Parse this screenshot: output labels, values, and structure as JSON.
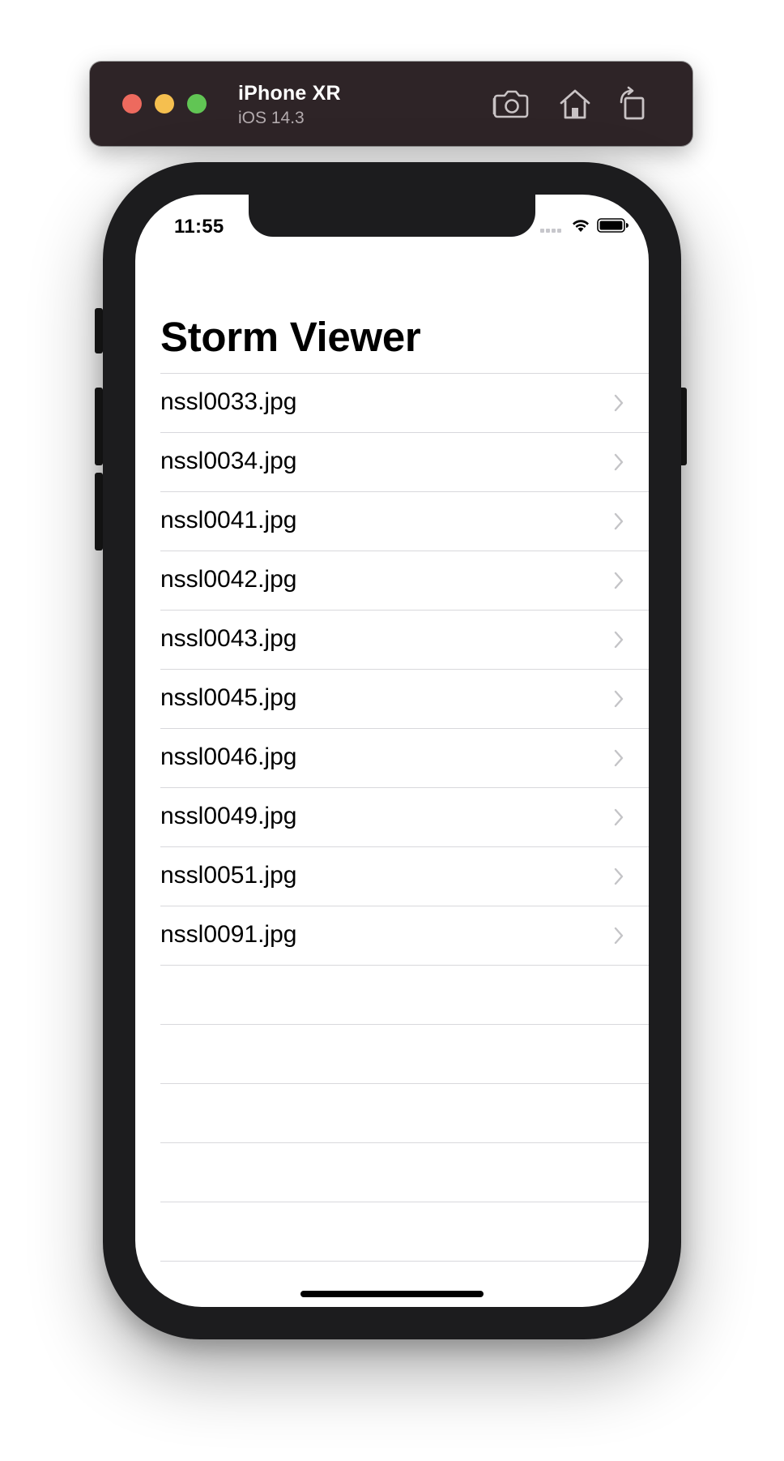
{
  "simulator": {
    "device_name": "iPhone XR",
    "os_version": "iOS 14.3",
    "icons": [
      "screenshot-icon",
      "home-icon",
      "rotate-icon"
    ]
  },
  "status_bar": {
    "time": "11:55",
    "icons": [
      "cellular-signal-icon",
      "wifi-icon",
      "battery-icon"
    ]
  },
  "navigation": {
    "title": "Storm Viewer"
  },
  "list": {
    "items": [
      {
        "label": "nssl0033.jpg"
      },
      {
        "label": "nssl0034.jpg"
      },
      {
        "label": "nssl0041.jpg"
      },
      {
        "label": "nssl0042.jpg"
      },
      {
        "label": "nssl0043.jpg"
      },
      {
        "label": "nssl0045.jpg"
      },
      {
        "label": "nssl0046.jpg"
      },
      {
        "label": "nssl0049.jpg"
      },
      {
        "label": "nssl0051.jpg"
      },
      {
        "label": "nssl0091.jpg"
      }
    ]
  },
  "colors": {
    "toolbar_bg": "#2e2427",
    "phone_frame": "#1c1c1e",
    "separator": "#d8d8dc",
    "chevron": "#c4c4c7",
    "close": "#ed6a5e",
    "minimize": "#f5bf4f",
    "zoom": "#61c554"
  }
}
